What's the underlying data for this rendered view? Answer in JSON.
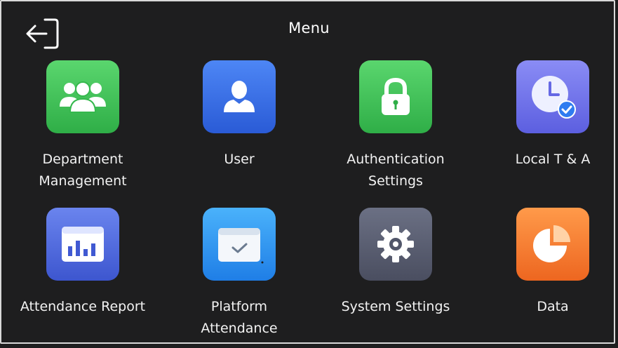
{
  "header": {
    "title": "Menu",
    "back_icon": "exit-arrow-icon"
  },
  "menu": {
    "items": [
      {
        "label": "Department\nManagement",
        "icon": "department-group-icon",
        "color": "#3ec456"
      },
      {
        "label": "User",
        "icon": "user-icon",
        "color": "#3a70ea"
      },
      {
        "label": "Authentication\nSettings",
        "icon": "padlock-icon",
        "color": "#3ec456"
      },
      {
        "label": "Local T & A",
        "icon": "clock-check-icon",
        "color": "#7274ea"
      },
      {
        "label": "Attendance Report",
        "icon": "bar-chart-report-icon",
        "color": "#5470e0"
      },
      {
        "label": "Platform\nAttendance",
        "icon": "calendar-check-icon",
        "color": "#3499f2"
      },
      {
        "label": "System Settings",
        "icon": "gear-icon",
        "color": "#5b6072"
      },
      {
        "label": "Data",
        "icon": "pie-chart-icon",
        "color": "#f47c34"
      }
    ]
  }
}
